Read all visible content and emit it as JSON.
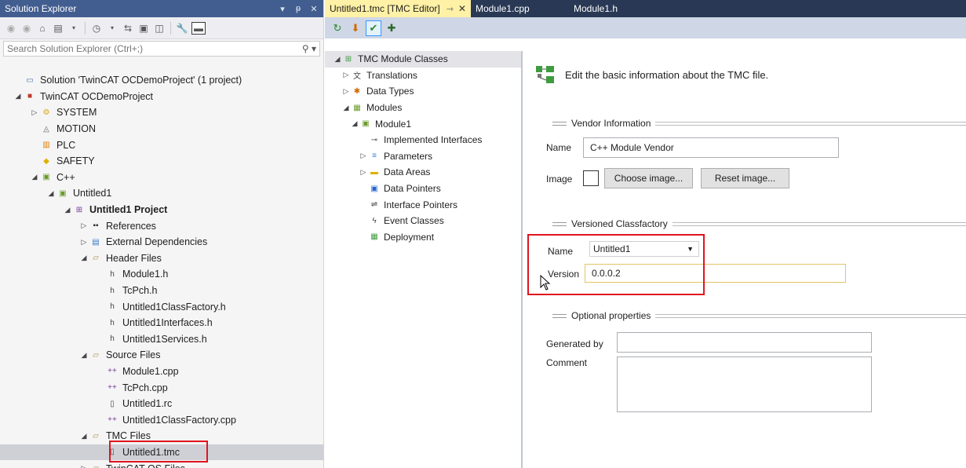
{
  "solution_explorer": {
    "title": "Solution Explorer",
    "title_buttons": [
      "▾",
      "ᵽ",
      "✕"
    ],
    "search_placeholder": "Search Solution Explorer (Ctrl+;)",
    "tree": [
      {
        "label": "Solution 'TwinCAT OCDemoProject' (1 project)",
        "level": 0,
        "arrow": "",
        "icon": "solution-icon"
      },
      {
        "label": "TwinCAT OCDemoProject",
        "level": 0,
        "arrow": "◢",
        "icon": "twincat-project-icon"
      },
      {
        "label": "SYSTEM",
        "level": 1,
        "arrow": "▷",
        "icon": "system-icon"
      },
      {
        "label": "MOTION",
        "level": 1,
        "arrow": "",
        "icon": "motion-icon"
      },
      {
        "label": "PLC",
        "level": 1,
        "arrow": "",
        "icon": "plc-icon"
      },
      {
        "label": "SAFETY",
        "level": 1,
        "arrow": "",
        "icon": "safety-icon"
      },
      {
        "label": "C++",
        "level": 1,
        "arrow": "◢",
        "icon": "cpp-icon"
      },
      {
        "label": "Untitled1",
        "level": 2,
        "arrow": "◢",
        "icon": "cpp-module-icon"
      },
      {
        "label": "Untitled1 Project",
        "level": 3,
        "arrow": "◢",
        "icon": "cpp-project-icon",
        "bold": true
      },
      {
        "label": "References",
        "level": 4,
        "arrow": "▷",
        "icon": "references-icon"
      },
      {
        "label": "External Dependencies",
        "level": 4,
        "arrow": "▷",
        "icon": "external-deps-icon"
      },
      {
        "label": "Header Files",
        "level": 4,
        "arrow": "◢",
        "icon": "folder-icon"
      },
      {
        "label": "Module1.h",
        "level": 5,
        "arrow": "",
        "icon": "header-file-icon"
      },
      {
        "label": "TcPch.h",
        "level": 5,
        "arrow": "",
        "icon": "header-file-icon"
      },
      {
        "label": "Untitled1ClassFactory.h",
        "level": 5,
        "arrow": "",
        "icon": "header-file-icon"
      },
      {
        "label": "Untitled1Interfaces.h",
        "level": 5,
        "arrow": "",
        "icon": "header-file-icon"
      },
      {
        "label": "Untitled1Services.h",
        "level": 5,
        "arrow": "",
        "icon": "header-file-icon"
      },
      {
        "label": "Source Files",
        "level": 4,
        "arrow": "◢",
        "icon": "folder-icon"
      },
      {
        "label": "Module1.cpp",
        "level": 5,
        "arrow": "",
        "icon": "cpp-file-icon"
      },
      {
        "label": "TcPch.cpp",
        "level": 5,
        "arrow": "",
        "icon": "cpp-file-icon"
      },
      {
        "label": "Untitled1.rc",
        "level": 5,
        "arrow": "",
        "icon": "resource-file-icon"
      },
      {
        "label": "Untitled1ClassFactory.cpp",
        "level": 5,
        "arrow": "",
        "icon": "cpp-file-icon"
      },
      {
        "label": "TMC Files",
        "level": 4,
        "arrow": "◢",
        "icon": "folder-icon"
      },
      {
        "label": "Untitled1.tmc",
        "level": 5,
        "arrow": "",
        "icon": "file-icon",
        "selected": true
      },
      {
        "label": "TwinCAT OS Files",
        "level": 4,
        "arrow": "▷",
        "icon": "folder-icon"
      }
    ]
  },
  "editor": {
    "tabs": [
      {
        "label": "Untitled1.tmc [TMC Editor]",
        "active": true,
        "pin": "⇾",
        "close": "✕"
      },
      {
        "label": "Module1.cpp",
        "active": false
      },
      {
        "label": "Module1.h",
        "active": false
      }
    ],
    "tmc_tree": [
      {
        "label": "TMC Module Classes",
        "level": 0,
        "arrow": "◢",
        "icon": "tmc-classes-icon",
        "selected": true
      },
      {
        "label": "Translations",
        "level": 1,
        "arrow": "▷",
        "icon": "translations-icon"
      },
      {
        "label": "Data Types",
        "level": 1,
        "arrow": "▷",
        "icon": "data-types-icon"
      },
      {
        "label": "Modules",
        "level": 1,
        "arrow": "◢",
        "icon": "modules-icon"
      },
      {
        "label": "Module1",
        "level": 2,
        "arrow": "◢",
        "icon": "module-icon"
      },
      {
        "label": "Implemented Interfaces",
        "level": 3,
        "arrow": "",
        "icon": "interfaces-icon"
      },
      {
        "label": "Parameters",
        "level": 3,
        "arrow": "▷",
        "icon": "parameters-icon"
      },
      {
        "label": "Data Areas",
        "level": 3,
        "arrow": "▷",
        "icon": "data-areas-icon"
      },
      {
        "label": "Data Pointers",
        "level": 3,
        "arrow": "",
        "icon": "data-pointers-icon"
      },
      {
        "label": "Interface Pointers",
        "level": 3,
        "arrow": "",
        "icon": "interface-pointers-icon"
      },
      {
        "label": "Event Classes",
        "level": 3,
        "arrow": "",
        "icon": "event-classes-icon"
      },
      {
        "label": "Deployment",
        "level": 3,
        "arrow": "",
        "icon": "deployment-icon"
      }
    ],
    "properties": {
      "header": "Edit the basic information about the TMC file.",
      "vendor_group": "Vendor Information",
      "name_label": "Name",
      "vendor_name": "C++ Module Vendor",
      "image_label": "Image",
      "choose_image": "Choose image...",
      "reset_image": "Reset image...",
      "classfactory_group": "Versioned Classfactory",
      "cf_name_label": "Name",
      "cf_name_value": "Untitled1",
      "version_label": "Version",
      "version_value": "0.0.0.2",
      "optional_group": "Optional properties",
      "generated_by_label": "Generated by",
      "generated_by_value": "",
      "comment_label": "Comment",
      "comment_value": ""
    }
  }
}
